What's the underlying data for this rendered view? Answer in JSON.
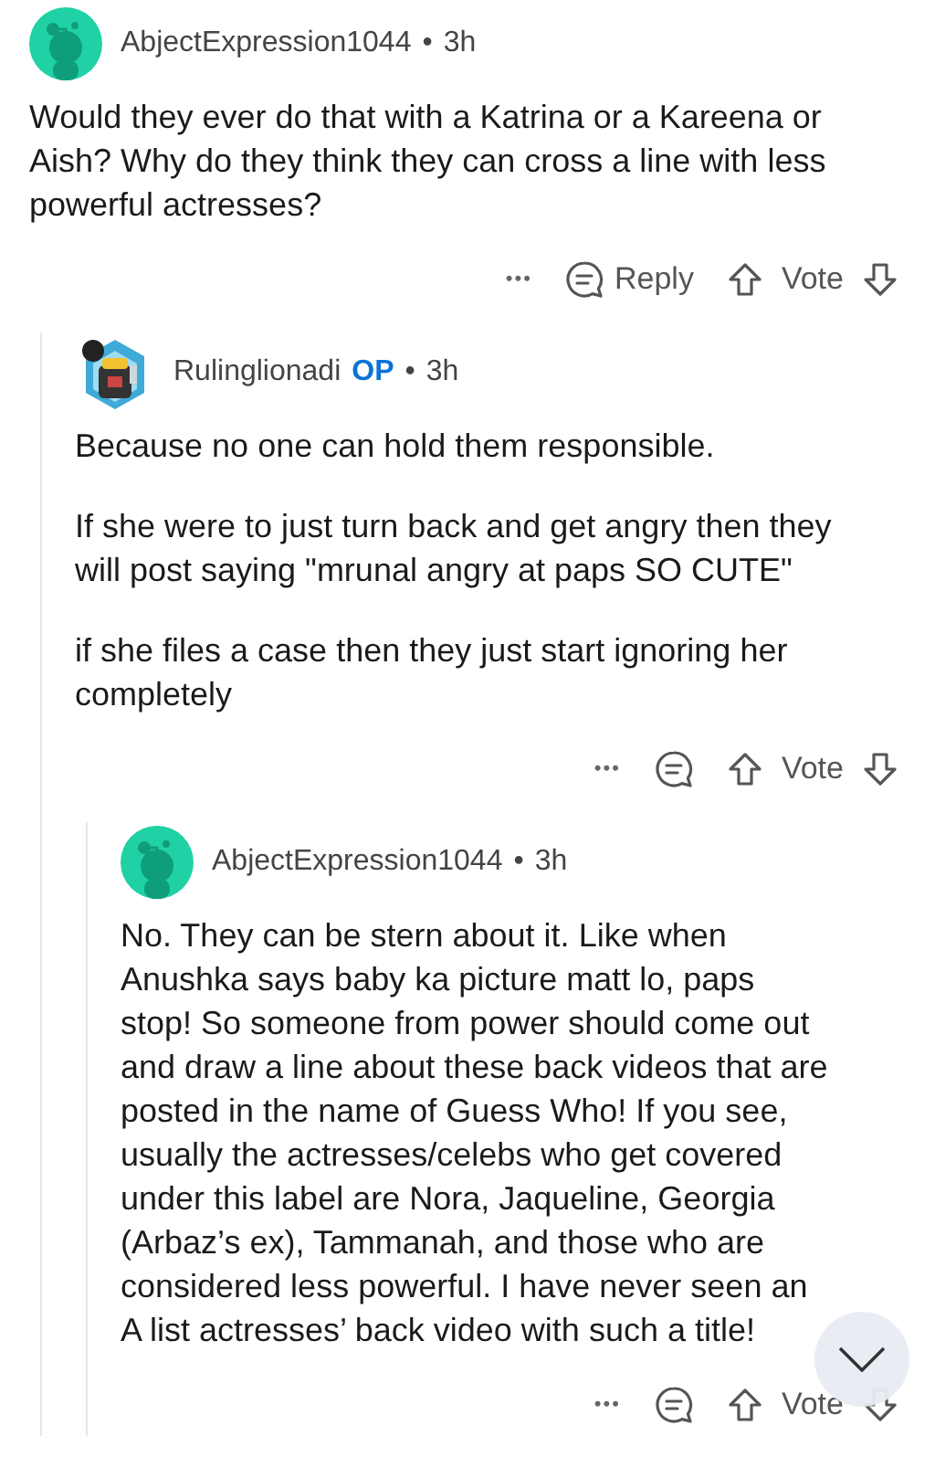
{
  "comments": [
    {
      "author": "AbjectExpression1044",
      "avatar": {
        "kind": "snoo"
      },
      "time": "3h",
      "separator": "•",
      "paragraphs": [
        "Would they ever do that with a Katrina or a Kareena or Aish? Why do they think they can cross a line with less powerful actresses?"
      ],
      "actions": {
        "more": "•••",
        "reply": "Reply",
        "vote": "Vote"
      },
      "children": [
        {
          "author": "Rulinglionadi",
          "avatar": {
            "kind": "custom"
          },
          "op": "OP",
          "time": "3h",
          "separator": "•",
          "paragraphs": [
            "Because no one can hold them responsible.",
            "If she were to just turn back and get angry then they will post saying \"mrunal angry at paps SO CUTE\"",
            "if she files a case then they just start ignoring her completely"
          ],
          "actions": {
            "more": "•••",
            "vote": "Vote"
          },
          "children": [
            {
              "author": "AbjectExpression1044",
              "avatar": {
                "kind": "snoo"
              },
              "time": "3h",
              "separator": "•",
              "paragraphs": [
                "No. They can be stern about it. Like when Anushka says baby ka picture matt lo, paps stop! So someone from power should come out and draw a line about these back videos that are posted in the name of Guess Who! If you see, usually the actresses/celebs who get covered under this label are Nora, Jaqueline, Georgia (Arbaz’s ex), Tammanah, and those who are considered less powerful. I have never seen an A list actresses’ back video with such a title!"
              ],
              "actions": {
                "more": "•••",
                "vote": "Vote"
              }
            }
          ]
        }
      ]
    }
  ]
}
